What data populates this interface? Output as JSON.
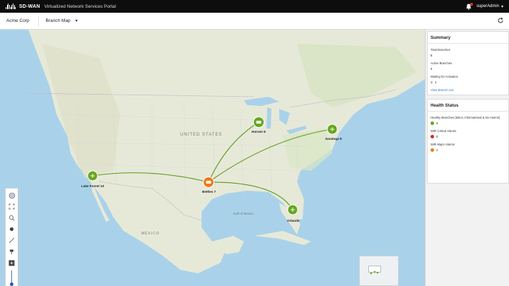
{
  "app": {
    "brand": "SD-WAN",
    "portal_title": "Virtualized Network Services Portal",
    "user": "superAdmin"
  },
  "subbar": {
    "organization": "Acme Corp",
    "view": "Branch Map"
  },
  "map": {
    "labels": {
      "country_us": "UNITED STATES",
      "country_mx": "MÉXICO",
      "gulf": "Gulf of Mexico"
    },
    "branches": [
      {
        "name": "Lake Forest 10",
        "status": "healthy"
      },
      {
        "name": "Bettles 7",
        "status": "major"
      },
      {
        "name": "Horsen 8",
        "status": "healthy"
      },
      {
        "name": "Saratoga 9",
        "status": "healthy"
      },
      {
        "name": "Orlando",
        "status": "healthy"
      }
    ]
  },
  "summary": {
    "title": "Summary",
    "total_label": "Total Branches",
    "total_value": "5",
    "active_label": "Active Branches",
    "active_value": "4",
    "waiting_label": "Waiting for Activation",
    "waiting_value": "1",
    "link": "View Branch List"
  },
  "health": {
    "title": "Health Status",
    "healthy_label": "Healthy Branches (Minor, Informational & No Alarms)",
    "healthy_value": "3",
    "critical_label": "With Critical Alarms",
    "critical_value": "0",
    "major_label": "With Major Alarms",
    "major_value": "1"
  },
  "colors": {
    "healthy": "#66a71f",
    "critical": "#d52b1e",
    "major": "#ef7a1a",
    "link": "#2f6fce",
    "water": "#a9d2ea",
    "land": "#e8eadb"
  }
}
